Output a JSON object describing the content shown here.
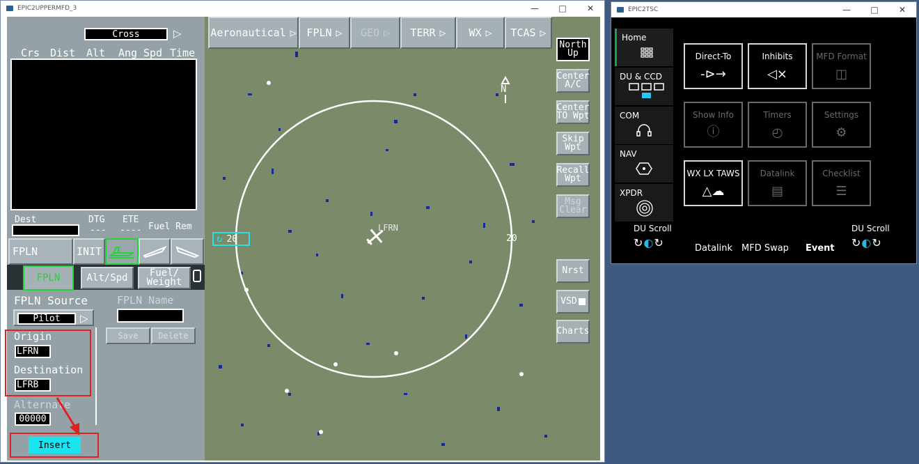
{
  "mfd_window": {
    "title": "EPIC2UPPERMFD_3",
    "controls": [
      "—",
      "□",
      "✕"
    ]
  },
  "tsc_window": {
    "title": "EPIC2TSC",
    "controls": [
      "—",
      "□",
      "✕"
    ]
  },
  "fpln_panel": {
    "mode_field": "Cross",
    "columns": [
      "Crs",
      "Dist",
      "Alt",
      "Ang",
      "Spd",
      "Time"
    ],
    "dest_label": "Dest",
    "dtg_label": "DTG",
    "dtg_value": "---",
    "ete_label": "ETE",
    "ete_value": "----",
    "fuel_rem_label": "Fuel Rem",
    "tabs_row1": [
      "FPLN",
      "INIT"
    ],
    "tabs_row2": [
      "FPLN",
      "Alt/Spd",
      "Fuel/\nWeight"
    ],
    "fpln_source_label": "FPLN Source",
    "fpln_source_value": "Pilot",
    "fpln_name_label": "FPLN Name",
    "save_label": "Save",
    "delete_label": "Delete",
    "origin_label": "Origin",
    "origin_value": "LFRN",
    "destination_label": "Destination",
    "destination_value": "LFRB",
    "alternate_label": "Alternate",
    "alternate_value": "00000",
    "insert_label": "Insert"
  },
  "map": {
    "top_buttons": [
      "Aeronautical",
      "FPLN",
      "GEO",
      "TERR",
      "WX",
      "TCAS"
    ],
    "side_buttons": [
      "North\nUp",
      "Center\nA/C",
      "Center\nTO Wpt",
      "Skip\nWpt",
      "Recall\nWpt",
      "Msg\nClear",
      "Nrst",
      "VSD",
      "Charts"
    ],
    "range_left": "20",
    "range_right": "20",
    "airport_label": "LFRN",
    "north_label": "N",
    "colors": {
      "map_bg": "#7b8b6a",
      "water": "#1a2a8a",
      "range_ring": "#ffffff",
      "cyan": "#29e0e6"
    }
  },
  "tsc": {
    "nav": [
      {
        "label": "Home",
        "icon": "grid-icon"
      },
      {
        "label": "DU & CCD",
        "icon": "display-units-icon"
      },
      {
        "label": "COM",
        "icon": "headset-icon"
      },
      {
        "label": "NAV",
        "icon": "nav-hexagon-icon"
      },
      {
        "label": "XPDR",
        "icon": "transponder-icon"
      }
    ],
    "tiles": [
      {
        "label": "Direct-To",
        "icon": "→",
        "enabled": true
      },
      {
        "label": "Inhibits",
        "icon": "🔇",
        "enabled": true
      },
      {
        "label": "MFD Format",
        "icon": "▯",
        "enabled": false
      },
      {
        "label": "Show Info",
        "icon": "ⓘ",
        "enabled": false
      },
      {
        "label": "Timers",
        "icon": "⏱",
        "enabled": false
      },
      {
        "label": "Settings",
        "icon": "⚙",
        "enabled": false
      },
      {
        "label": "WX LX TAWS",
        "icon": "☁",
        "enabled": true
      },
      {
        "label": "Datalink",
        "icon": "▤",
        "enabled": false
      },
      {
        "label": "Checklist",
        "icon": "☰",
        "enabled": false
      }
    ],
    "du_scroll_left": "DU Scroll",
    "du_scroll_right": "DU Scroll",
    "footer": [
      "Datalink",
      "MFD Swap",
      "Event"
    ]
  }
}
